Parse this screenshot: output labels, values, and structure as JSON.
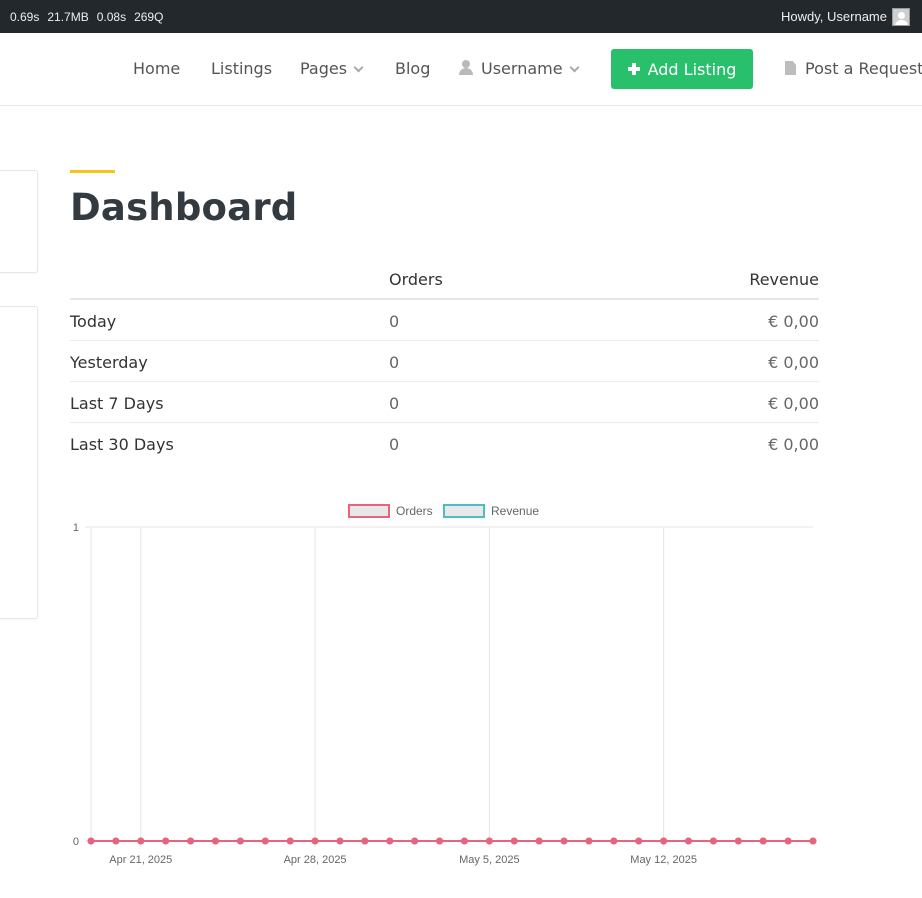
{
  "adminbar": {
    "stats": [
      "0.69s",
      "21.7MB",
      "0.08s",
      "269Q"
    ],
    "howdy": "Howdy, Username"
  },
  "nav": {
    "home": "Home",
    "listings": "Listings",
    "pages": "Pages",
    "blog": "Blog",
    "user": "Username",
    "add_listing": "Add Listing",
    "post_request": "Post a Request"
  },
  "colors": {
    "accent": "#f5c518",
    "add_button": "#28c06a",
    "orders_series": "#e8647e",
    "revenue_series": "#4dbdc3"
  },
  "dashboard": {
    "title": "Dashboard",
    "table": {
      "headers": [
        "",
        "Orders",
        "Revenue"
      ],
      "rows": [
        {
          "label": "Today",
          "orders": "0",
          "revenue": "€ 0,00"
        },
        {
          "label": "Yesterday",
          "orders": "0",
          "revenue": "€ 0,00"
        },
        {
          "label": "Last 7 Days",
          "orders": "0",
          "revenue": "€ 0,00"
        },
        {
          "label": "Last 30 Days",
          "orders": "0",
          "revenue": "€ 0,00"
        }
      ]
    }
  },
  "chart_data": {
    "type": "line",
    "title": "",
    "xlabel": "",
    "ylabel": "",
    "legend_position": "top-center",
    "ylim": [
      0,
      1
    ],
    "y_ticks": [
      "0",
      "1"
    ],
    "x_start": "2025-04-19",
    "x_end": "2025-05-18",
    "x_ticks": [
      {
        "date": "2025-04-21",
        "label": "Apr 21, 2025"
      },
      {
        "date": "2025-04-28",
        "label": "Apr 28, 2025"
      },
      {
        "date": "2025-05-05",
        "label": "May 5, 2025"
      },
      {
        "date": "2025-05-12",
        "label": "May 12, 2025"
      }
    ],
    "grid": true,
    "series": [
      {
        "name": "Orders",
        "color": "#e8647e",
        "values": [
          0,
          0,
          0,
          0,
          0,
          0,
          0,
          0,
          0,
          0,
          0,
          0,
          0,
          0,
          0,
          0,
          0,
          0,
          0,
          0,
          0,
          0,
          0,
          0,
          0,
          0,
          0,
          0,
          0,
          0
        ]
      },
      {
        "name": "Revenue",
        "color": "#4dbdc3",
        "values": [
          0,
          0,
          0,
          0,
          0,
          0,
          0,
          0,
          0,
          0,
          0,
          0,
          0,
          0,
          0,
          0,
          0,
          0,
          0,
          0,
          0,
          0,
          0,
          0,
          0,
          0,
          0,
          0,
          0,
          0
        ]
      }
    ]
  }
}
